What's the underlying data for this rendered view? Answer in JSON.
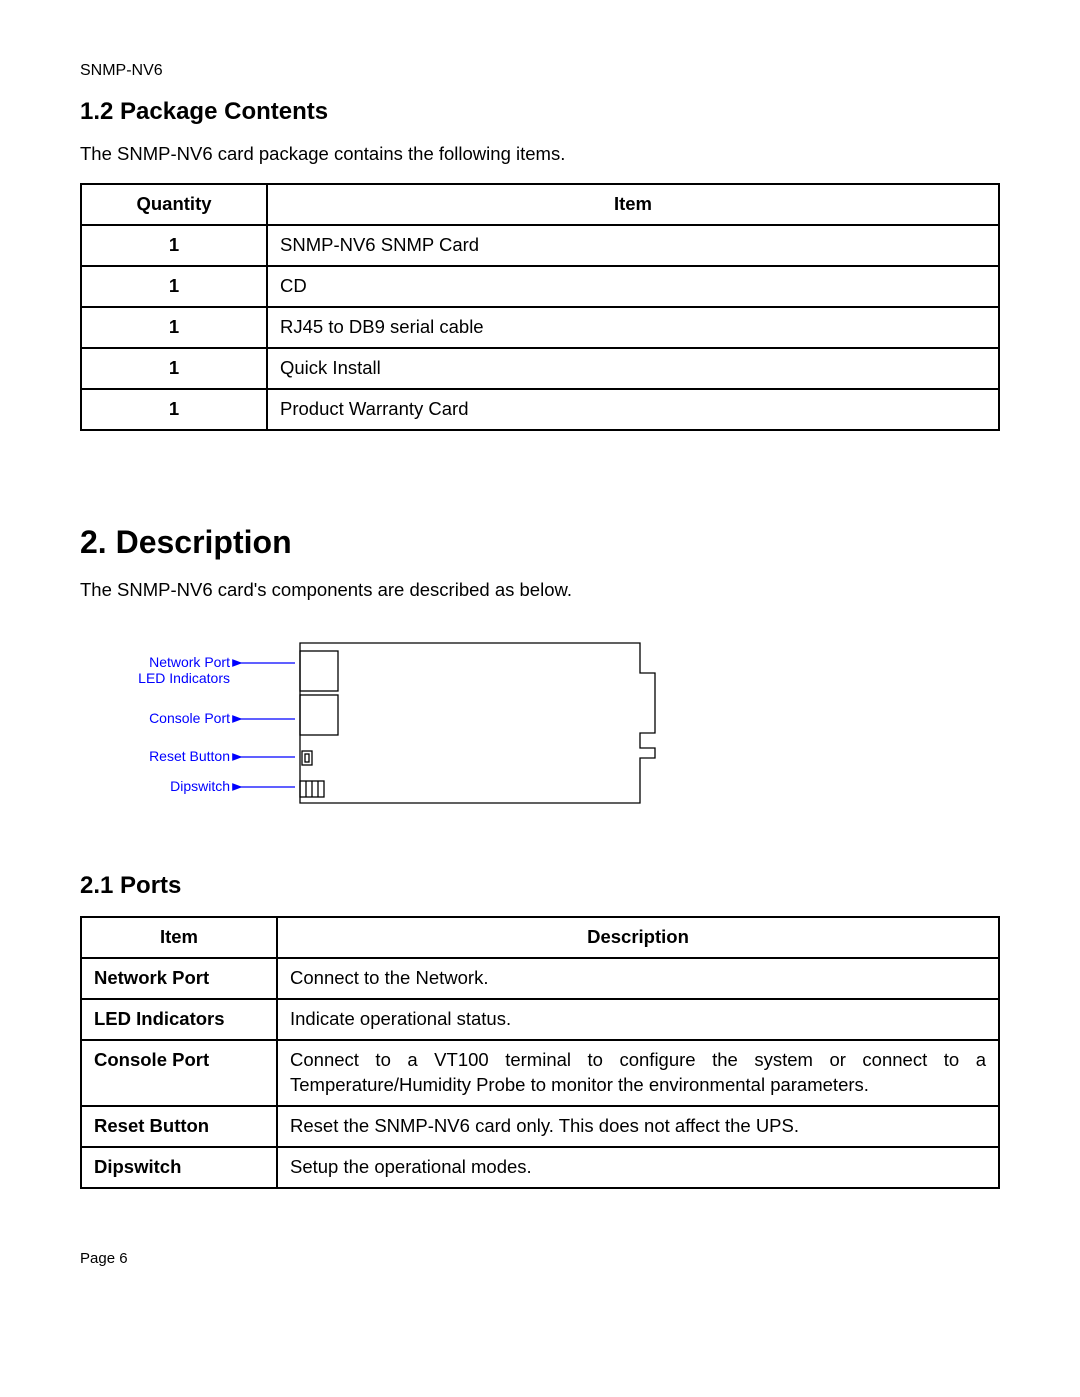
{
  "header": {
    "doc_id": "SNMP-NV6"
  },
  "sections": {
    "pkg": {
      "heading": "1.2 Package Contents",
      "intro": "The SNMP-NV6 card package contains the following items.",
      "headers": {
        "qty": "Quantity",
        "item": "Item"
      },
      "rows": [
        {
          "qty": "1",
          "item": "SNMP-NV6 SNMP Card"
        },
        {
          "qty": "1",
          "item": "CD"
        },
        {
          "qty": "1",
          "item": "RJ45 to DB9 serial cable"
        },
        {
          "qty": "1",
          "item": "Quick Install"
        },
        {
          "qty": "1",
          "item": "Product Warranty Card"
        }
      ]
    },
    "desc": {
      "heading": "2. Description",
      "intro": "The SNMP-NV6 card's components are described as below.",
      "diagram_labels": {
        "network": "Network Port",
        "led": "LED Indicators",
        "console": "Console Port",
        "reset": "Reset Button",
        "dip": "Dipswitch"
      }
    },
    "ports": {
      "heading": "2.1 Ports",
      "headers": {
        "item": "Item",
        "desc": "Description"
      },
      "rows": [
        {
          "item": "Network Port",
          "desc": "Connect to the Network."
        },
        {
          "item": "LED Indicators",
          "desc": "Indicate operational status."
        },
        {
          "item": "Console Port",
          "desc": "Connect to a VT100 terminal to configure the system or connect to a Temperature/Humidity Probe to monitor the environmental parameters."
        },
        {
          "item": "Reset Button",
          "desc": "Reset the SNMP-NV6 card only. This does not affect the UPS."
        },
        {
          "item": "Dipswitch",
          "desc": "Setup the operational modes."
        }
      ]
    }
  },
  "footer": {
    "page": "Page 6"
  }
}
